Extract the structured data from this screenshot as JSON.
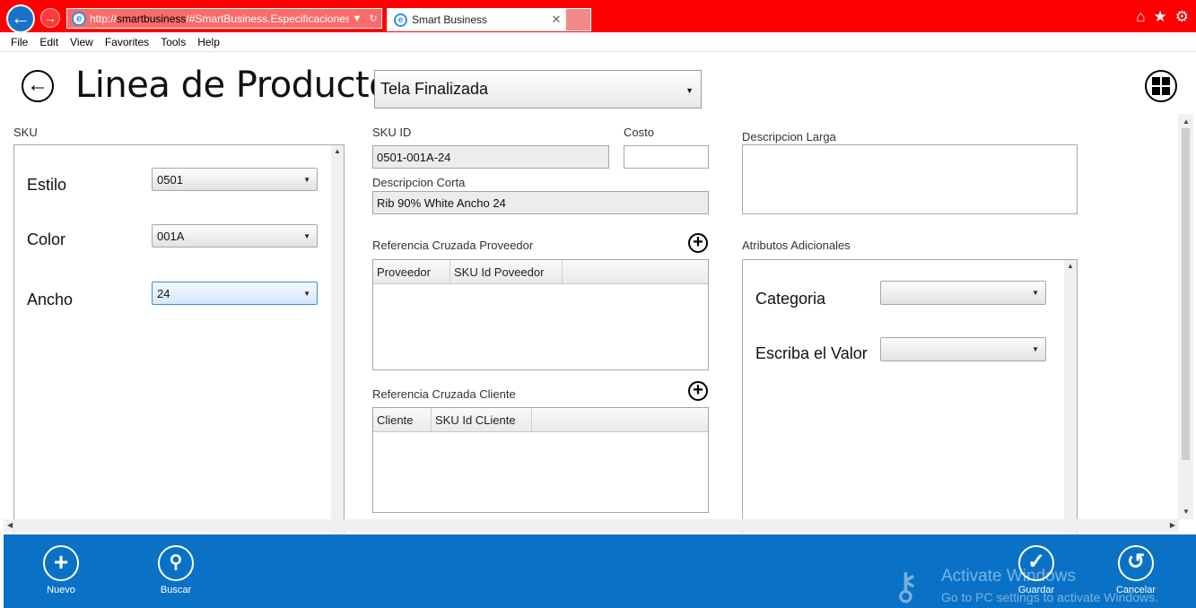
{
  "browser": {
    "url_prefix": "http://",
    "url_host": "smartbusiness",
    "url_rest": "/#SmartBusiness.Especificaciones!",
    "tab_title": "Smart Business",
    "menu": [
      "File",
      "Edit",
      "View",
      "Favorites",
      "Tools",
      "Help"
    ]
  },
  "page": {
    "title": "Linea de Producto",
    "type_select": "Tela Finalizada"
  },
  "sku": {
    "section_label": "SKU",
    "fields": [
      {
        "label": "Estilo",
        "value": "0501"
      },
      {
        "label": "Color",
        "value": "001A"
      },
      {
        "label": "Ancho",
        "value": "24"
      }
    ]
  },
  "detail": {
    "sku_id_label": "SKU ID",
    "sku_id_value": "0501-001A-24",
    "costo_label": "Costo",
    "costo_value": "",
    "desc_corta_label": "Descripcion Corta",
    "desc_corta_value": "Rib 90% White Ancho 24",
    "desc_larga_label": "Descripcion Larga",
    "desc_larga_value": ""
  },
  "ref_proveedor": {
    "label": "Referencia Cruzada Proveedor",
    "columns": [
      "Proveedor",
      "SKU Id Poveedor"
    ]
  },
  "ref_cliente": {
    "label": "Referencia Cruzada Cliente",
    "columns": [
      "Cliente",
      "SKU Id CLiente"
    ]
  },
  "atributos": {
    "label": "Atributos Adicionales",
    "fields": [
      {
        "label": "Categoria",
        "value": ""
      },
      {
        "label": "Escriba el Valor",
        "value": ""
      }
    ]
  },
  "appbar": {
    "nuevo": "Nuevo",
    "buscar": "Buscar",
    "guardar": "Guardar",
    "cancelar": "Cancelar"
  },
  "watermark": {
    "line1": "Activate Windows",
    "line2": "Go to PC settings to activate Windows."
  },
  "colors": {
    "browser_frame": "#ff0000",
    "appbar": "#0a72c6"
  }
}
